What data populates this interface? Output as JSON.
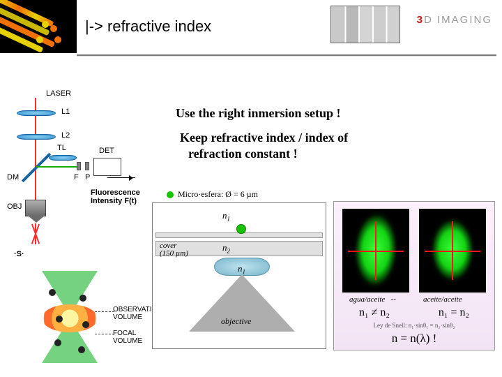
{
  "header": {
    "title": "|-> refractive index",
    "logo_prefix": "3",
    "logo_mid": "D",
    "logo_suffix": " IMAGING"
  },
  "main": {
    "line1": "Use the right inmersion setup !",
    "line2a": "Keep refractive index / index of",
    "line2b": "refraction constant !"
  },
  "optics": {
    "laser": "LASER",
    "l1": "L1",
    "l2": "L2",
    "tl": "TL",
    "dm": "DM",
    "f": "F",
    "p": "P",
    "det": "DET",
    "obj": "OBJ",
    "s": "S",
    "fluorescence": "Fluorescence",
    "intensity": "Intensity F(t)"
  },
  "cone": {
    "obsvol": "OBSERVATION",
    "obsvol2": "VOLUME",
    "focal": "FOCAL VOLUME"
  },
  "diagram": {
    "bead_note": "Micro·esfera: Ø = 6 µm",
    "n1": "n",
    "n2": "n",
    "cover": "cover",
    "coverthk": "(150 µm)",
    "n1b": "n",
    "objective": "objective"
  },
  "compare": {
    "cap_left": "agua/aceite",
    "cap_right": "aceite/aceite",
    "dash": "--",
    "eq_left": "n₁ ≠ n₂",
    "eq_right": "n₁ = n₂",
    "snell": "Ley de Snell: n₁·sinθ₁ = n₂·sinθ₂",
    "final": "n = n(λ) !"
  }
}
